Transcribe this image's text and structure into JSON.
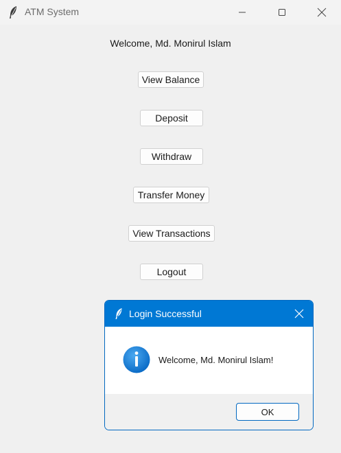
{
  "window": {
    "title": "ATM System",
    "icon": "feather-icon",
    "controls": [
      "minimize-icon",
      "maximize-icon",
      "close-icon"
    ]
  },
  "main": {
    "welcome": "Welcome, Md. Monirul Islam",
    "buttons": {
      "view_balance": "View Balance",
      "deposit": "Deposit",
      "withdraw": "Withdraw",
      "transfer_money": "Transfer Money",
      "view_transactions": "View Transactions",
      "logout": "Logout"
    }
  },
  "dialog": {
    "title": "Login Successful",
    "icon": "info-icon",
    "message": "Welcome, Md. Monirul Islam!",
    "ok_label": "OK"
  },
  "colors": {
    "window_bg": "#f0f0f0",
    "dialog_accent": "#0078d4",
    "info_icon": "#1e88e5"
  }
}
